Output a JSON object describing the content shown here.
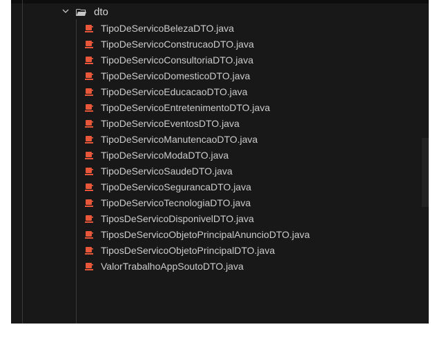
{
  "explorer": {
    "folder": {
      "name": "dto",
      "expanded": true,
      "icon": "folder-open-icon"
    },
    "file_icon": "java-file-icon",
    "accent_color": "#e8573a",
    "files": [
      "TipoDeServicoBelezaDTO.java",
      "TipoDeServicoConstrucaoDTO.java",
      "TipoDeServicoConsultoriaDTO.java",
      "TipoDeServicoDomesticoDTO.java",
      "TipoDeServicoEducacaoDTO.java",
      "TipoDeServicoEntretenimentoDTO.java",
      "TipoDeServicoEventosDTO.java",
      "TipoDeServicoManutencaoDTO.java",
      "TipoDeServicoModaDTO.java",
      "TipoDeServicoSaudeDTO.java",
      "TipoDeServicoSegurancaDTO.java",
      "TipoDeServicoTecnologiaDTO.java",
      "TiposDeServicoDisponivelDTO.java",
      "TiposDeServicoObjetoPrincipalAnuncioDTO.java",
      "TiposDeServicoObjetoPrincipalDTO.java",
      "ValorTrabalhoAppSoutoDTO.java"
    ]
  }
}
